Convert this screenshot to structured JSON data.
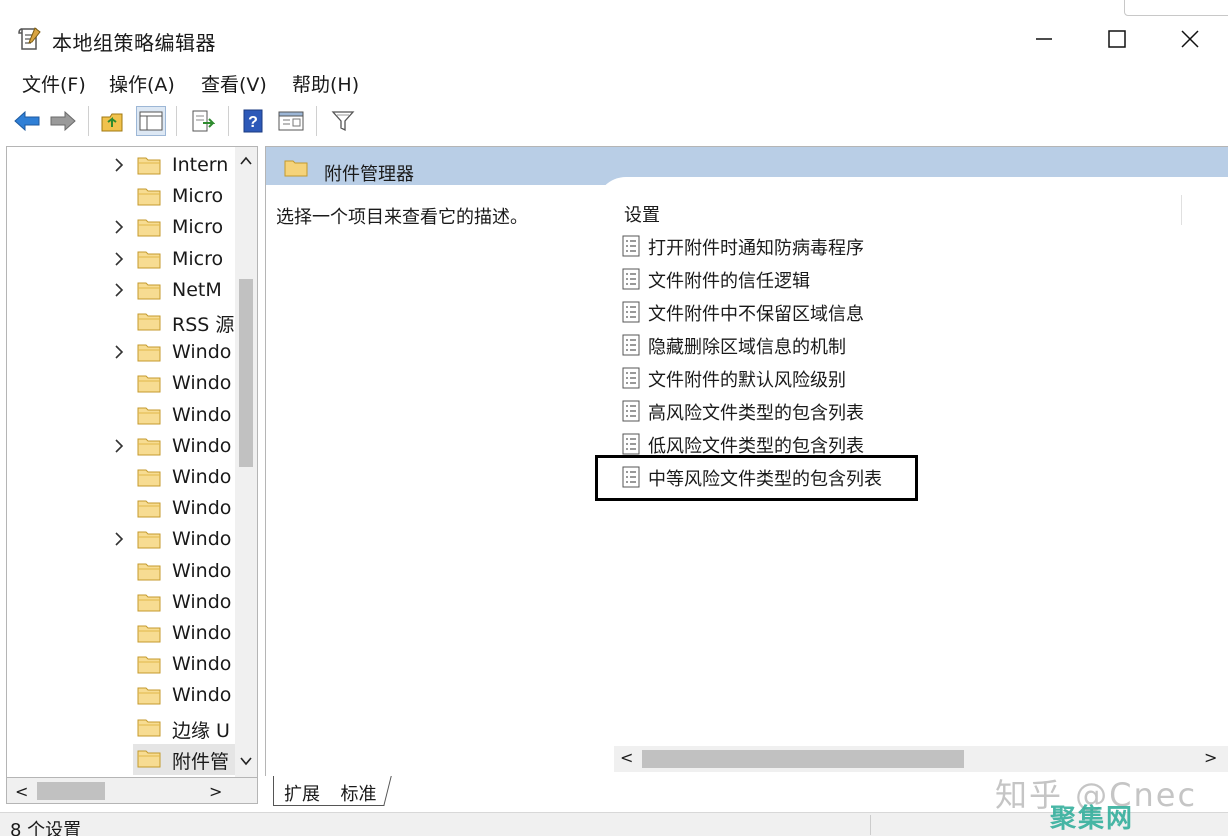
{
  "window": {
    "title": "本地组策略编辑器",
    "controls": [
      "minimize",
      "maximize",
      "close"
    ]
  },
  "menu": [
    {
      "label": "文件(F)"
    },
    {
      "label": "操作(A)"
    },
    {
      "label": "查看(V)"
    },
    {
      "label": "帮助(H)"
    }
  ],
  "toolbar": {
    "icons": [
      "back-icon",
      "forward-icon",
      "up-folder-icon",
      "show-tree-icon",
      "export-icon",
      "help-icon",
      "properties-icon",
      "filter-icon"
    ]
  },
  "tree": {
    "items": [
      {
        "label": "Intern",
        "expandable": true
      },
      {
        "label": "Micro",
        "expandable": false
      },
      {
        "label": "Micro",
        "expandable": true
      },
      {
        "label": "Micro",
        "expandable": true
      },
      {
        "label": "NetM",
        "expandable": true
      },
      {
        "label": "RSS 源",
        "expandable": false
      },
      {
        "label": "Windo",
        "expandable": true
      },
      {
        "label": "Windo",
        "expandable": false
      },
      {
        "label": "Windo",
        "expandable": false
      },
      {
        "label": "Windo",
        "expandable": true
      },
      {
        "label": "Windo",
        "expandable": false
      },
      {
        "label": "Windo",
        "expandable": false
      },
      {
        "label": "Windo",
        "expandable": true
      },
      {
        "label": "Windo",
        "expandable": false
      },
      {
        "label": "Windo",
        "expandable": false
      },
      {
        "label": "Windo",
        "expandable": false
      },
      {
        "label": "Windo",
        "expandable": false
      },
      {
        "label": "Windo",
        "expandable": false
      },
      {
        "label": "边缘 U",
        "expandable": false
      },
      {
        "label": "附件管",
        "expandable": false,
        "selected": true
      }
    ]
  },
  "details": {
    "header": "附件管理器",
    "description": "选择一个项目来查看它的描述。",
    "column_header": "设置",
    "settings": [
      {
        "label": "打开附件时通知防病毒程序"
      },
      {
        "label": "文件附件的信任逻辑"
      },
      {
        "label": "文件附件中不保留区域信息"
      },
      {
        "label": "隐藏删除区域信息的机制"
      },
      {
        "label": "文件附件的默认风险级别"
      },
      {
        "label": "高风险文件类型的包含列表"
      },
      {
        "label": "低风险文件类型的包含列表"
      },
      {
        "label": "中等风险文件类型的包含列表",
        "highlighted": true
      }
    ]
  },
  "tabs": [
    {
      "label": "扩展"
    },
    {
      "label": "标准"
    }
  ],
  "status": {
    "text": "8 个设置"
  },
  "watermark": {
    "line1": "知乎 @Cnec",
    "line2": "聚集网"
  },
  "colors": {
    "header_band": "#b9cee6",
    "folder": "#f5d37a",
    "selection": "#e5e5e5",
    "highlight_border": "#000000"
  }
}
